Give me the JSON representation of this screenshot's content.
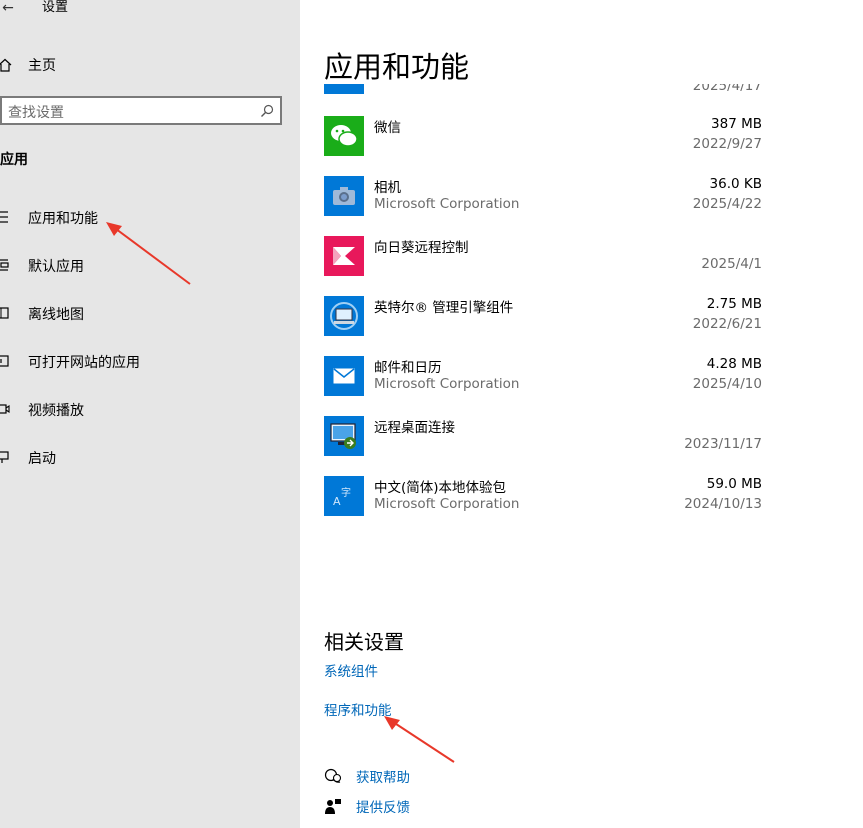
{
  "window": {
    "title": "设置"
  },
  "sidebar": {
    "home_label": "主页",
    "search_placeholder": "查找设置",
    "section_title": "应用",
    "items": [
      {
        "label": "应用和功能",
        "icon": "apps-features-icon"
      },
      {
        "label": "默认应用",
        "icon": "default-apps-icon"
      },
      {
        "label": "离线地图",
        "icon": "offline-maps-icon"
      },
      {
        "label": "可打开网站的应用",
        "icon": "apps-for-websites-icon"
      },
      {
        "label": "视频播放",
        "icon": "video-playback-icon"
      },
      {
        "label": "启动",
        "icon": "startup-icon"
      }
    ]
  },
  "main": {
    "title": "应用和功能",
    "partial_top_date": "2025/4/17",
    "apps": [
      {
        "name": "微信",
        "publisher": "",
        "size": "387 MB",
        "date": "2022/9/27",
        "icon": "wechat-icon",
        "color": "#1aad19"
      },
      {
        "name": "相机",
        "publisher": "Microsoft Corporation",
        "size": "36.0 KB",
        "date": "2025/4/22",
        "icon": "camera-icon",
        "color": "#0078d7"
      },
      {
        "name": "向日葵远程控制",
        "publisher": "",
        "size": "",
        "date": "2025/4/1",
        "icon": "sunlogin-icon",
        "color": "#e8185b"
      },
      {
        "name": "英特尔® 管理引擎组件",
        "publisher": "",
        "size": "2.75 MB",
        "date": "2022/6/21",
        "icon": "intel-me-icon",
        "color": "#0078d7"
      },
      {
        "name": "邮件和日历",
        "publisher": "Microsoft Corporation",
        "size": "4.28 MB",
        "date": "2025/4/10",
        "icon": "mail-icon",
        "color": "#0078d7"
      },
      {
        "name": "远程桌面连接",
        "publisher": "",
        "size": "",
        "date": "2023/11/17",
        "icon": "remote-desktop-icon",
        "color": "#0078d7"
      },
      {
        "name": "中文(简体)本地体验包",
        "publisher": "Microsoft Corporation",
        "size": "59.0 MB",
        "date": "2024/10/13",
        "icon": "language-pack-icon",
        "color": "#0078d7"
      }
    ],
    "related": {
      "title": "相关设置",
      "links": [
        "系统组件",
        "程序和功能"
      ]
    },
    "help": {
      "get_help": "获取帮助",
      "feedback": "提供反馈"
    }
  },
  "colors": {
    "accent": "#0067b8",
    "sidebar_bg": "#e6e6e6",
    "annotation_arrow": "#e8382a"
  }
}
